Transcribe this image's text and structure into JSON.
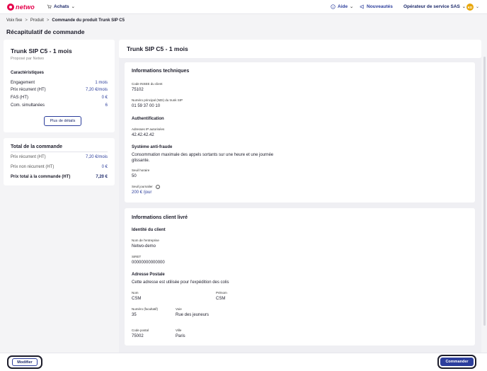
{
  "header": {
    "logo_text": "netwo",
    "nav_achats": "Achats",
    "aide": "Aide",
    "nouveautes": "Nouveautés",
    "operator": "Opérateur de service SAS",
    "avatar_initials": "KD"
  },
  "breadcrumb": [
    "Voix fixe",
    "Produit",
    "Commande du produit Trunk SIP C5"
  ],
  "page_title": "Récapitulatif de commande",
  "summary": {
    "title": "Trunk SIP C5 - 1 mois",
    "subtitle": "Proposé par Netwo",
    "section": "Caractéristiques",
    "rows": [
      {
        "label": "Engagement",
        "value": "1 mois"
      },
      {
        "label": "Prix récurrent (HT)",
        "value": "7,20 €/mois"
      },
      {
        "label": "FAS (HT)",
        "value": "0 €"
      },
      {
        "label": "Com. simultanées",
        "value": "6"
      }
    ],
    "details_button": "Plus de détails"
  },
  "total": {
    "title": "Total de la commande",
    "rows": [
      {
        "label": "Prix récurrent (HT)",
        "value": "7,20 €/mois"
      },
      {
        "label": "Prix non récurrent (HT)",
        "value": "0 €"
      },
      {
        "label": "Prix total à la commande (HT)",
        "value": "7,20 €"
      }
    ]
  },
  "main": {
    "title": "Trunk SIP C5 - 1 mois",
    "tech": {
      "title": "Informations techniques",
      "insee_label": "Code INSEE du client",
      "insee_value": "75102",
      "ndi_label": "Numéro principal (NDI) du trunk SIP",
      "ndi_value": "01 59 37 00 10",
      "auth_title": "Authentification",
      "ip_label": "Adresses IP autorisées",
      "ip_value": "42.42.42.42",
      "fraud_title": "Système anti-fraude",
      "fraud_desc": "Consommation maximale des appels sortants sur une heure et une journée glissante.",
      "hourly_label": "Seuil horaire",
      "hourly_value": "50",
      "daily_label": "Seuil journalier",
      "daily_value": "200 € /jour"
    },
    "client": {
      "title": "Informations client livré",
      "identity_title": "Identité du client",
      "company_label": "Nom de l'entreprise",
      "company_value": "Netwo-demo",
      "siret_label": "SIRET",
      "siret_value": "00000000000000",
      "postal_title": "Adresse Postale",
      "postal_desc": "Cette adresse est utilisée pour l'expédition des colis",
      "nom_label": "Nom",
      "nom_value": "CSM",
      "prenom_label": "Prénom",
      "prenom_value": "CSM",
      "numero_label": "Numéro (facultatif)",
      "numero_value": "35",
      "voie_label": "Voie",
      "voie_value": "Rue des jeuneurs",
      "cp_label": "Code postal",
      "cp_value": "75002",
      "ville_label": "Ville",
      "ville_value": "Paris"
    }
  },
  "footer": {
    "modify_button": "Modifier",
    "order_button": "Commander"
  }
}
